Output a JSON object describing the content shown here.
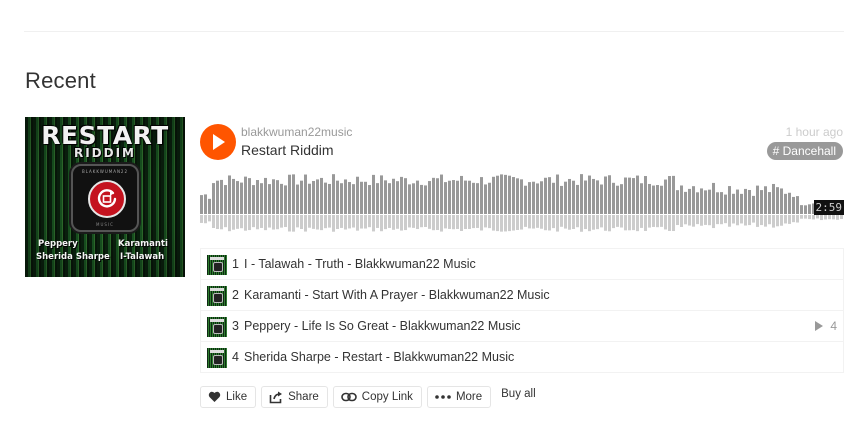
{
  "section": {
    "title": "Recent"
  },
  "artwork": {
    "title": "RESTART",
    "subtitle": "RIDDIM",
    "device_brand": "BLAKKWUMAN22",
    "device_footer": "MUSIC",
    "artists": [
      "Peppery",
      "Karamanti",
      "Sherida Sharpe",
      "I-Talawah"
    ]
  },
  "track": {
    "uploader": "blakkwuman22music",
    "title": "Restart Riddim",
    "posted": "1 hour ago",
    "tag": "# Dancehall",
    "duration": "2:59"
  },
  "tracklist": [
    {
      "num": "1",
      "name": "I - Talawah - Truth - Blakkwuman22 Music",
      "plays": ""
    },
    {
      "num": "2",
      "name": "Karamanti - Start With A Prayer - Blakkwuman22 Music",
      "plays": ""
    },
    {
      "num": "3",
      "name": "Peppery - Life Is So Great - Blakkwuman22 Music",
      "plays": "4"
    },
    {
      "num": "4",
      "name": "Sherida Sharpe - Restart - Blakkwuman22 Music",
      "plays": ""
    }
  ],
  "actions": {
    "like": "Like",
    "share": "Share",
    "copy_link": "Copy Link",
    "more": "More",
    "buy_all": "Buy all"
  },
  "colors": {
    "accent": "#ff5500",
    "waveform": "#999999",
    "tag_bg": "#999999"
  },
  "icons": {
    "play": "play-icon",
    "like": "heart-icon",
    "share": "share-icon",
    "copy_link": "link-icon",
    "more": "more-icon",
    "plays": "play-count-icon"
  }
}
